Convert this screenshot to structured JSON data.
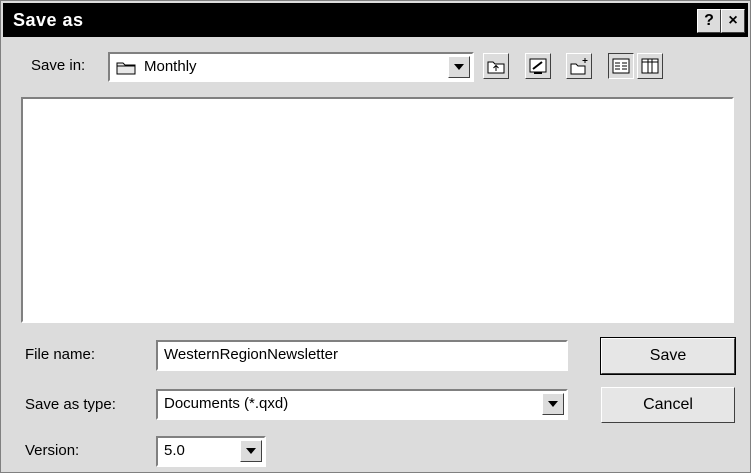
{
  "window": {
    "title": "Save as"
  },
  "titlebar": {
    "help_label": "?",
    "close_label": "×"
  },
  "save_in": {
    "label": "Save in:",
    "value": "Monthly"
  },
  "toolbar": {
    "icons": [
      "up-folder-icon",
      "desktop-icon",
      "new-folder-icon",
      "list-view-icon",
      "details-view-icon"
    ]
  },
  "file_name": {
    "label": "File name:",
    "value": "WesternRegionNewsletter"
  },
  "save_as_type": {
    "label": "Save as type:",
    "value": "Documents (*.qxd)"
  },
  "version": {
    "label": "Version:",
    "value": "5.0"
  },
  "buttons": {
    "save": "Save",
    "cancel": "Cancel"
  }
}
